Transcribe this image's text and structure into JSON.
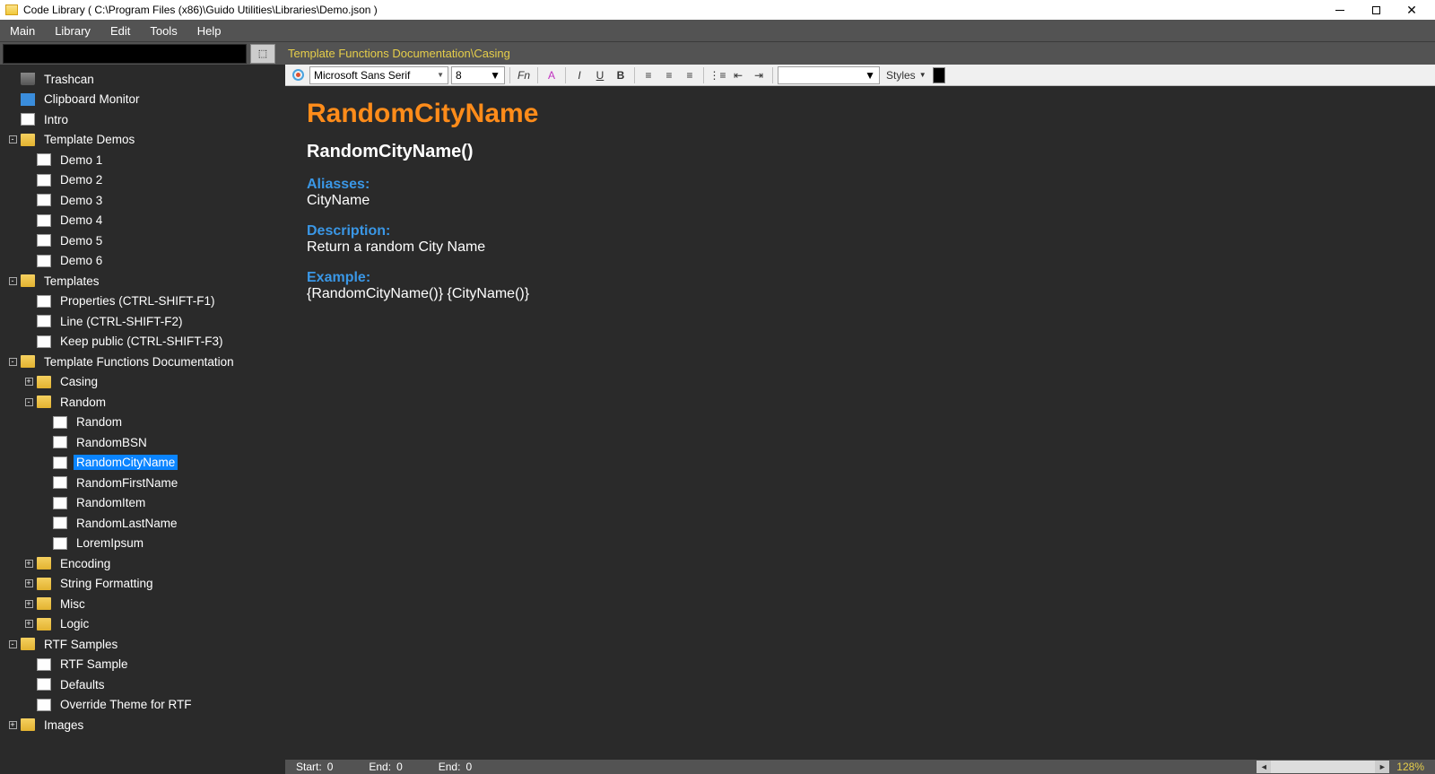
{
  "title": "Code Library ( C:\\Program Files (x86)\\Guido Utilities\\Libraries\\Demo.json )",
  "menu": [
    "Main",
    "Library",
    "Edit",
    "Tools",
    "Help"
  ],
  "breadcrumb": "Template Functions Documentation\\Casing",
  "font_name": "Microsoft Sans Serif",
  "font_size": "8",
  "styles_label": "Styles",
  "tree": [
    {
      "d": 0,
      "exp": "",
      "ico": "trash",
      "label": "Trashcan"
    },
    {
      "d": 0,
      "exp": "",
      "ico": "clip",
      "label": "Clipboard Monitor"
    },
    {
      "d": 0,
      "exp": "",
      "ico": "file",
      "label": "Intro"
    },
    {
      "d": 0,
      "exp": "-",
      "ico": "folder",
      "label": "Template Demos"
    },
    {
      "d": 1,
      "exp": "",
      "ico": "file",
      "label": "Demo 1"
    },
    {
      "d": 1,
      "exp": "",
      "ico": "file",
      "label": "Demo 2"
    },
    {
      "d": 1,
      "exp": "",
      "ico": "file",
      "label": "Demo 3"
    },
    {
      "d": 1,
      "exp": "",
      "ico": "file",
      "label": "Demo 4"
    },
    {
      "d": 1,
      "exp": "",
      "ico": "file",
      "label": "Demo 5"
    },
    {
      "d": 1,
      "exp": "",
      "ico": "file",
      "label": "Demo 6"
    },
    {
      "d": 0,
      "exp": "-",
      "ico": "folder",
      "label": "Templates"
    },
    {
      "d": 1,
      "exp": "",
      "ico": "file",
      "label": "Properties (CTRL-SHIFT-F1)"
    },
    {
      "d": 1,
      "exp": "",
      "ico": "file",
      "label": "Line (CTRL-SHIFT-F2)"
    },
    {
      "d": 1,
      "exp": "",
      "ico": "file",
      "label": "Keep public (CTRL-SHIFT-F3)"
    },
    {
      "d": 0,
      "exp": "-",
      "ico": "folder",
      "label": "Template Functions Documentation"
    },
    {
      "d": 1,
      "exp": "+",
      "ico": "folder",
      "label": "Casing"
    },
    {
      "d": 1,
      "exp": "-",
      "ico": "folder",
      "label": "Random"
    },
    {
      "d": 2,
      "exp": "",
      "ico": "file",
      "label": "Random"
    },
    {
      "d": 2,
      "exp": "",
      "ico": "file",
      "label": "RandomBSN"
    },
    {
      "d": 2,
      "exp": "",
      "ico": "file",
      "label": "RandomCityName",
      "selected": true
    },
    {
      "d": 2,
      "exp": "",
      "ico": "file",
      "label": "RandomFirstName"
    },
    {
      "d": 2,
      "exp": "",
      "ico": "file",
      "label": "RandomItem"
    },
    {
      "d": 2,
      "exp": "",
      "ico": "file",
      "label": "RandomLastName"
    },
    {
      "d": 2,
      "exp": "",
      "ico": "file",
      "label": "LoremIpsum"
    },
    {
      "d": 1,
      "exp": "+",
      "ico": "folder",
      "label": "Encoding"
    },
    {
      "d": 1,
      "exp": "+",
      "ico": "folder",
      "label": "String Formatting"
    },
    {
      "d": 1,
      "exp": "+",
      "ico": "folder",
      "label": "Misc"
    },
    {
      "d": 1,
      "exp": "+",
      "ico": "folder",
      "label": "Logic"
    },
    {
      "d": 0,
      "exp": "-",
      "ico": "folder",
      "label": "RTF Samples"
    },
    {
      "d": 1,
      "exp": "",
      "ico": "file",
      "label": "RTF Sample"
    },
    {
      "d": 1,
      "exp": "",
      "ico": "file",
      "label": "Defaults"
    },
    {
      "d": 1,
      "exp": "",
      "ico": "file",
      "label": "Override Theme for RTF"
    },
    {
      "d": 0,
      "exp": "+",
      "ico": "folder",
      "label": "Images"
    }
  ],
  "doc": {
    "title": "RandomCityName",
    "signature": "RandomCityName()",
    "aliases_label": "Aliasses:",
    "aliases": "CityName",
    "description_label": "Description:",
    "description": "Return a random City Name",
    "example_label": "Example:",
    "example": "{RandomCityName()} {CityName()}"
  },
  "status": {
    "start_label": "Start:",
    "start_val": "0",
    "end1_label": "End:",
    "end1_val": "0",
    "end2_label": "End:",
    "end2_val": "0",
    "zoom": "128%"
  }
}
